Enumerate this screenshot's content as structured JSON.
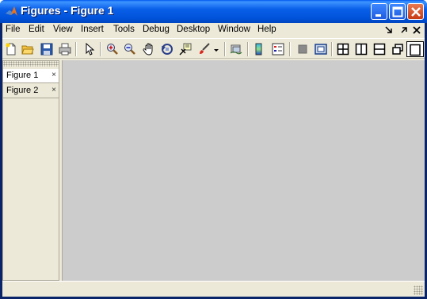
{
  "window": {
    "title": "Figures - Figure 1"
  },
  "titlebar_buttons": [
    "minimize-icon",
    "maximize-icon",
    "close-icon"
  ],
  "menu": [
    "File",
    "Edit",
    "View",
    "Insert",
    "Tools",
    "Debug",
    "Desktop",
    "Window",
    "Help"
  ],
  "menubar_controls": [
    "dock-arrow-icon",
    "undock-icon",
    "close-icon"
  ],
  "toolbar": [
    "new-figure-icon",
    "open-file-icon",
    "save-icon",
    "print-icon",
    "edit-plot-arrow-icon",
    "zoom-in-icon",
    "zoom-out-icon",
    "pan-hand-icon",
    "rotate-3d-icon",
    "data-cursor-icon",
    "brush-icon",
    "brush-dropdown-icon",
    "link-plot-icon",
    "colorbar-icon",
    "legend-icon",
    "hide-plot-tools-icon",
    "show-plot-tools-icon",
    "tile-2x2-icon",
    "tile-left-right-icon",
    "tile-top-bottom-icon",
    "float-icon",
    "maximize-figure-icon"
  ],
  "document_bar": {
    "tabs": [
      {
        "label": "Figure 1",
        "selected": true
      },
      {
        "label": "Figure 2",
        "selected": false
      }
    ],
    "close_glyph": "×"
  },
  "colors": {
    "titlebar": "#0a5fe8",
    "frame": "#ece9d8",
    "canvas": "#cccccc"
  }
}
